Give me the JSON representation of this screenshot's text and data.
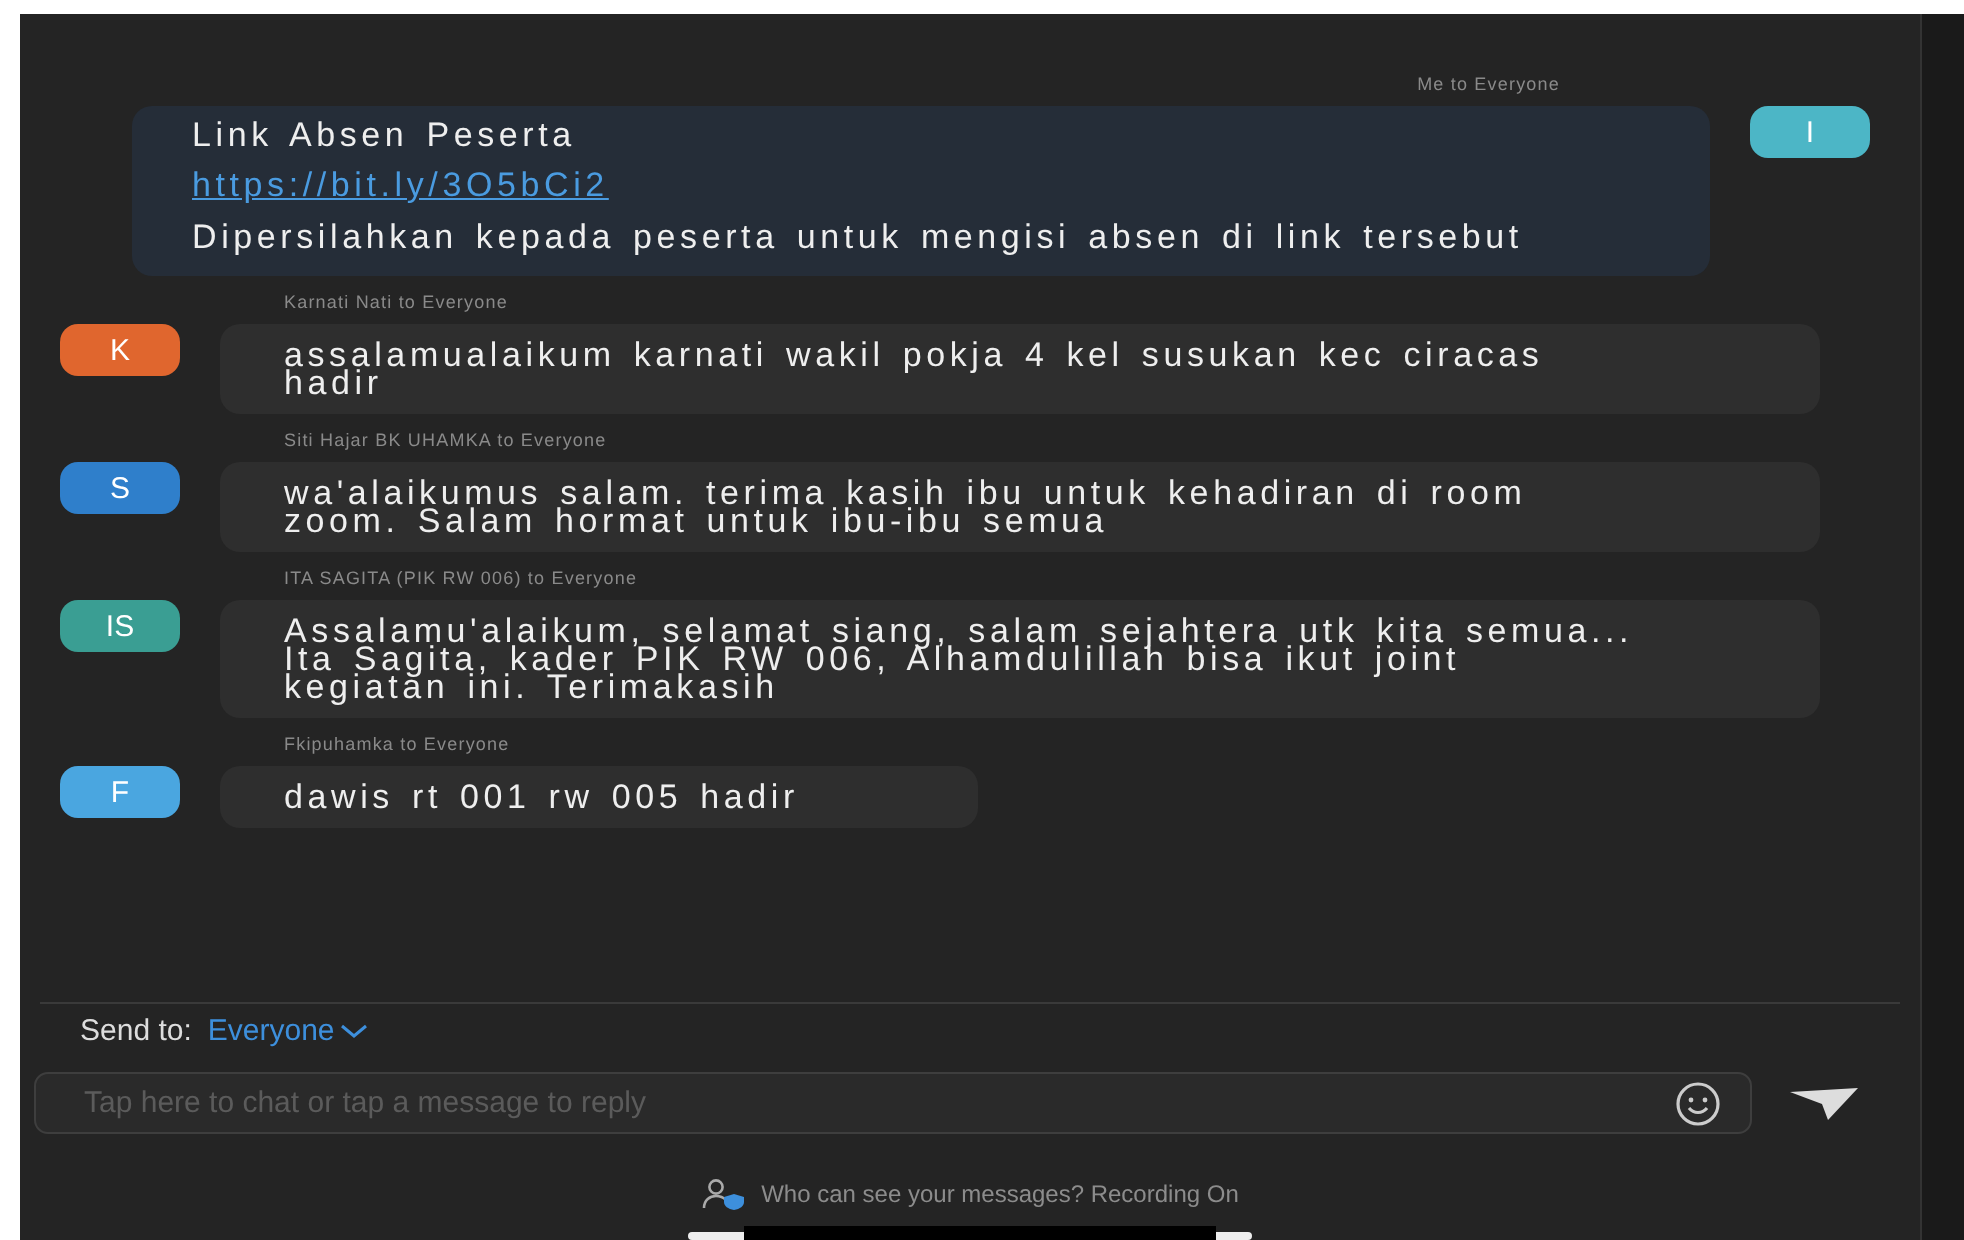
{
  "messages": [
    {
      "sender": "Me to Everyone",
      "mine": true,
      "avatar": "I",
      "color": "#4cb6c6",
      "lines": [
        {
          "kind": "text",
          "text": "Link Absen Peserta"
        },
        {
          "kind": "link",
          "text": "https://bit.ly/3O5bCi2"
        },
        {
          "kind": "text",
          "text": "Dipersilahkan kepada peserta untuk mengisi absen di link tersebut"
        }
      ]
    },
    {
      "sender": "Karnati Nati to Everyone",
      "mine": false,
      "avatar": "K",
      "color": "#e0662e",
      "lines": [
        {
          "kind": "text",
          "text": "assalamualaikum karnati wakil pokja 4 kel susukan kec ciracas hadir"
        }
      ]
    },
    {
      "sender": "Siti Hajar BK UHAMKA to Everyone",
      "mine": false,
      "avatar": "S",
      "color": "#2f7fcb",
      "lines": [
        {
          "kind": "text",
          "text": "wa'alaikumus salam. terima kasih ibu untuk kehadiran di room zoom. Salam hormat untuk ibu-ibu semua"
        }
      ]
    },
    {
      "sender": "ITA SAGITA (PIK RW 006) to Everyone",
      "mine": false,
      "avatar": "IS",
      "color": "#3a9e93",
      "lines": [
        {
          "kind": "text",
          "text": "Assalamu'alaikum, selamat siang, salam sejahtera utk kita semua... Ita Sagita, kader PIK RW 006, Alhamdulillah bisa ikut joint kegiatan ini. Terimakasih"
        }
      ]
    },
    {
      "sender": "Fkipuhamka to Everyone",
      "mine": false,
      "avatar": "F",
      "color": "#4aa6e0",
      "lines": [
        {
          "kind": "text",
          "text": "dawis rt 001 rw 005 hadir"
        }
      ]
    }
  ],
  "send_to": {
    "label": "Send to:",
    "value": "Everyone"
  },
  "input": {
    "placeholder": "Tap here to chat or tap a message to reply"
  },
  "footer": "Who can see your messages? Recording On"
}
